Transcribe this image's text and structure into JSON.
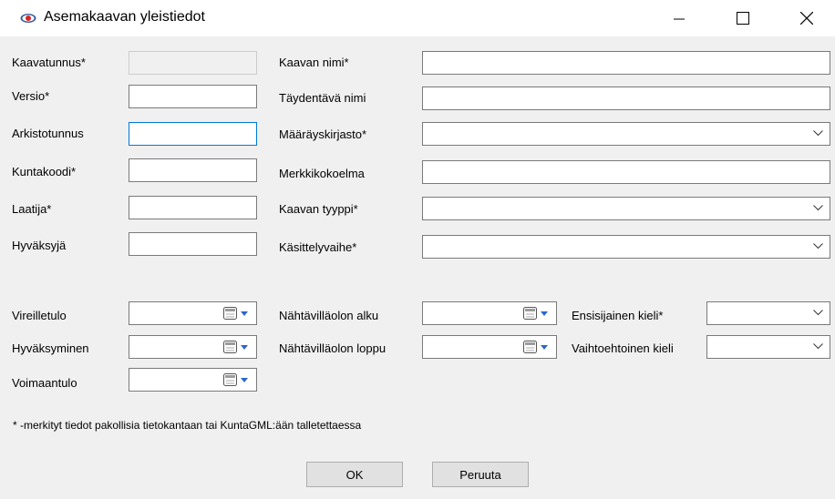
{
  "window": {
    "title": "Asemakaavan yleistiedot",
    "icons": {
      "app": "eye-icon",
      "minimize": "minimize-icon",
      "maximize": "maximize-icon",
      "close": "close-icon"
    }
  },
  "labels": {
    "kaavatunnus": "Kaavatunnus*",
    "versio": "Versio*",
    "arkistotunnus": "Arkistotunnus",
    "kuntakoodi": "Kuntakoodi*",
    "laatija": "Laatija*",
    "hyvaksyja": "Hyväksyjä",
    "kaavan_nimi": "Kaavan nimi*",
    "taydentava_nimi": "Täydentävä nimi",
    "maarayskirjasto": "Määräyskirjasto*",
    "merkkikokoelma": "Merkkikokoelma",
    "kaavan_tyyppi": "Kaavan tyyppi*",
    "kasittelyvaihe": "Käsittelyvaihe*",
    "vireilletulo": "Vireilletulo",
    "hyvaksyminen": "Hyväksyminen",
    "voimaantulo": "Voimaantulo",
    "nahtavillaolon_alku": "Nähtävilläolon alku",
    "nahtavillaolon_loppu": "Nähtävilläolon loppu",
    "ensisijainen_kieli": "Ensisijainen kieli*",
    "vaihtoehtoinen_kieli": "Vaihtoehtoinen kieli"
  },
  "values": {
    "kaavatunnus": "",
    "versio": "",
    "arkistotunnus": "",
    "kuntakoodi": "",
    "laatija": "",
    "hyvaksyja": "",
    "kaavan_nimi": "",
    "taydentava_nimi": "",
    "maarayskirjasto": "",
    "merkkikokoelma": "",
    "kaavan_tyyppi": "",
    "kasittelyvaihe": "",
    "vireilletulo": "",
    "hyvaksyminen": "",
    "voimaantulo": "",
    "nahtavillaolon_alku": "",
    "nahtavillaolon_loppu": "",
    "ensisijainen_kieli": "",
    "vaihtoehtoinen_kieli": ""
  },
  "note": "* -merkityt tiedot pakollisia tietokantaan tai KuntaGML:ään talletettaessa",
  "buttons": {
    "ok": "OK",
    "cancel": "Peruuta"
  },
  "colors": {
    "focus_border": "#0078d7",
    "field_border": "#7a7a7a",
    "background": "#f0f0f0"
  }
}
